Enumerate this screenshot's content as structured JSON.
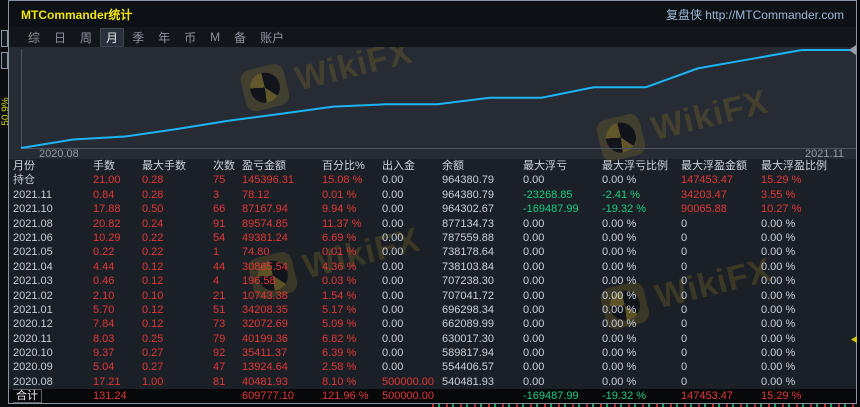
{
  "window": {
    "title": "MTCommander统计",
    "brand": "复盘侠 http://MTCommander.com"
  },
  "menu": {
    "items": [
      {
        "label": "综",
        "selected": false
      },
      {
        "label": "日",
        "selected": false
      },
      {
        "label": "周",
        "selected": false
      },
      {
        "label": "月",
        "selected": true
      },
      {
        "label": "季",
        "selected": false
      },
      {
        "label": "年",
        "selected": false
      },
      {
        "label": "币",
        "selected": false
      },
      {
        "label": "M",
        "selected": false
      },
      {
        "label": "备",
        "selected": false
      },
      {
        "label": "账户",
        "selected": false
      }
    ]
  },
  "chart_data": {
    "type": "line",
    "title": "账户余额曲线",
    "x_start_label": "2020.08",
    "x_end_label": "2021.11",
    "ylim": [
      500000,
      964381
    ],
    "line_color": "#1db4f6",
    "grid": false,
    "legend": false,
    "series": [
      {
        "name": "余额",
        "start_value": 500000,
        "x": [
          "2020.08",
          "2020.09",
          "2020.10",
          "2020.11",
          "2020.12",
          "2021.01",
          "2021.02",
          "2021.03",
          "2021.04",
          "2021.05",
          "2021.06",
          "2021.07",
          "2021.08",
          "2021.09",
          "2021.10",
          "2021.11"
        ],
        "y": [
          540481.93,
          554406.57,
          589817.94,
          630017.3,
          662089.99,
          696298.34,
          707041.72,
          707238.3,
          738103.84,
          738178.64,
          787559.88,
          787559.88,
          877134.73,
          920718.7,
          964302.67,
          964380.79
        ]
      }
    ]
  },
  "watermark": {
    "text": "WikiFX"
  },
  "underlying": {
    "side_label": "50.9%"
  },
  "colors": {
    "title_yellow": "#f0e40a",
    "profit_red": "#e23636",
    "loss_green": "#16cd82",
    "equity_line": "#1db4f6"
  },
  "table": {
    "columns": [
      "月份",
      "手数",
      "最大手数",
      "次数",
      "盈亏金额",
      "百分比%",
      "出入金",
      "余额",
      "最大浮亏",
      "最大浮亏比例",
      "最大浮盈金额",
      "最大浮盈比例"
    ],
    "rows": [
      {
        "label": "持仓",
        "total": false,
        "cells": [
          [
            "21.00",
            "r"
          ],
          [
            "0.28",
            "r"
          ],
          [
            "75",
            "r"
          ],
          [
            "145396.31",
            "r"
          ],
          [
            "15.08 %",
            "r"
          ],
          [
            "0.00",
            "w"
          ],
          [
            "964380.79",
            "w"
          ],
          [
            "0.00",
            "w"
          ],
          [
            "0.00 %",
            "w"
          ],
          [
            "147453.47",
            "r"
          ],
          [
            "15.29 %",
            "r"
          ]
        ]
      },
      {
        "label": "2021.11",
        "total": false,
        "cells": [
          [
            "0.84",
            "r"
          ],
          [
            "0.28",
            "r"
          ],
          [
            "3",
            "r"
          ],
          [
            "78.12",
            "r"
          ],
          [
            "0.01 %",
            "r"
          ],
          [
            "0.00",
            "w"
          ],
          [
            "964380.79",
            "w"
          ],
          [
            "-23268.85",
            "g"
          ],
          [
            "-2.41 %",
            "g"
          ],
          [
            "34203.47",
            "r"
          ],
          [
            "3.55 %",
            "r"
          ]
        ]
      },
      {
        "label": "2021.10",
        "total": false,
        "cells": [
          [
            "17.88",
            "r"
          ],
          [
            "0.50",
            "r"
          ],
          [
            "66",
            "r"
          ],
          [
            "87167.94",
            "r"
          ],
          [
            "9.94 %",
            "r"
          ],
          [
            "0.00",
            "w"
          ],
          [
            "964302.67",
            "w"
          ],
          [
            "-169487.99",
            "g"
          ],
          [
            "-19.32 %",
            "g"
          ],
          [
            "90065.88",
            "r"
          ],
          [
            "10.27 %",
            "r"
          ]
        ]
      },
      {
        "label": "2021.08",
        "total": false,
        "cells": [
          [
            "20.82",
            "r"
          ],
          [
            "0.24",
            "r"
          ],
          [
            "91",
            "r"
          ],
          [
            "89574.85",
            "r"
          ],
          [
            "11.37 %",
            "r"
          ],
          [
            "0.00",
            "w"
          ],
          [
            "877134.73",
            "w"
          ],
          [
            "0.00",
            "w"
          ],
          [
            "0.00 %",
            "w"
          ],
          [
            "0",
            "w"
          ],
          [
            "0.00 %",
            "w"
          ]
        ]
      },
      {
        "label": "2021.06",
        "total": false,
        "cells": [
          [
            "10.29",
            "r"
          ],
          [
            "0.22",
            "r"
          ],
          [
            "54",
            "r"
          ],
          [
            "49381.24",
            "r"
          ],
          [
            "6.69 %",
            "r"
          ],
          [
            "0.00",
            "w"
          ],
          [
            "787559.88",
            "w"
          ],
          [
            "0.00",
            "w"
          ],
          [
            "0.00 %",
            "w"
          ],
          [
            "0",
            "w"
          ],
          [
            "0.00 %",
            "w"
          ]
        ]
      },
      {
        "label": "2021.05",
        "total": false,
        "cells": [
          [
            "0.22",
            "r"
          ],
          [
            "0.22",
            "r"
          ],
          [
            "1",
            "r"
          ],
          [
            "74.80",
            "r"
          ],
          [
            "0.01 %",
            "r"
          ],
          [
            "0.00",
            "w"
          ],
          [
            "738178.64",
            "w"
          ],
          [
            "0.00",
            "w"
          ],
          [
            "0.00 %",
            "w"
          ],
          [
            "0",
            "w"
          ],
          [
            "0.00 %",
            "w"
          ]
        ]
      },
      {
        "label": "2021.04",
        "total": false,
        "cells": [
          [
            "4.44",
            "r"
          ],
          [
            "0.12",
            "r"
          ],
          [
            "44",
            "r"
          ],
          [
            "30865.54",
            "r"
          ],
          [
            "4.36 %",
            "r"
          ],
          [
            "0.00",
            "w"
          ],
          [
            "738103.84",
            "w"
          ],
          [
            "0.00",
            "w"
          ],
          [
            "0.00 %",
            "w"
          ],
          [
            "0",
            "w"
          ],
          [
            "0.00 %",
            "w"
          ]
        ]
      },
      {
        "label": "2021.03",
        "total": false,
        "cells": [
          [
            "0.46",
            "r"
          ],
          [
            "0.12",
            "r"
          ],
          [
            "4",
            "r"
          ],
          [
            "196.58",
            "r"
          ],
          [
            "0.03 %",
            "r"
          ],
          [
            "0.00",
            "w"
          ],
          [
            "707238.30",
            "w"
          ],
          [
            "0.00",
            "w"
          ],
          [
            "0.00 %",
            "w"
          ],
          [
            "0",
            "w"
          ],
          [
            "0.00 %",
            "w"
          ]
        ]
      },
      {
        "label": "2021.02",
        "total": false,
        "cells": [
          [
            "2.10",
            "r"
          ],
          [
            "0.10",
            "r"
          ],
          [
            "21",
            "r"
          ],
          [
            "10743.38",
            "r"
          ],
          [
            "1.54 %",
            "r"
          ],
          [
            "0.00",
            "w"
          ],
          [
            "707041.72",
            "w"
          ],
          [
            "0.00",
            "w"
          ],
          [
            "0.00 %",
            "w"
          ],
          [
            "0",
            "w"
          ],
          [
            "0.00 %",
            "w"
          ]
        ]
      },
      {
        "label": "2021.01",
        "total": false,
        "cells": [
          [
            "5.70",
            "r"
          ],
          [
            "0.12",
            "r"
          ],
          [
            "51",
            "r"
          ],
          [
            "34208.35",
            "r"
          ],
          [
            "5.17 %",
            "r"
          ],
          [
            "0.00",
            "w"
          ],
          [
            "696298.34",
            "w"
          ],
          [
            "0.00",
            "w"
          ],
          [
            "0.00 %",
            "w"
          ],
          [
            "0",
            "w"
          ],
          [
            "0.00 %",
            "w"
          ]
        ]
      },
      {
        "label": "2020.12",
        "total": false,
        "cells": [
          [
            "7.84",
            "r"
          ],
          [
            "0.12",
            "r"
          ],
          [
            "73",
            "r"
          ],
          [
            "32072.69",
            "r"
          ],
          [
            "5.09 %",
            "r"
          ],
          [
            "0.00",
            "w"
          ],
          [
            "662089.99",
            "w"
          ],
          [
            "0.00",
            "w"
          ],
          [
            "0.00 %",
            "w"
          ],
          [
            "0",
            "w"
          ],
          [
            "0.00 %",
            "w"
          ]
        ]
      },
      {
        "label": "2020.11",
        "total": false,
        "cells": [
          [
            "8.03",
            "r"
          ],
          [
            "0.25",
            "r"
          ],
          [
            "79",
            "r"
          ],
          [
            "40199.36",
            "r"
          ],
          [
            "6.82 %",
            "r"
          ],
          [
            "0.00",
            "w"
          ],
          [
            "630017.30",
            "w"
          ],
          [
            "0.00",
            "w"
          ],
          [
            "0.00 %",
            "w"
          ],
          [
            "0",
            "w"
          ],
          [
            "0.00 %",
            "w"
          ]
        ]
      },
      {
        "label": "2020.10",
        "total": false,
        "cells": [
          [
            "9.37",
            "r"
          ],
          [
            "0.27",
            "r"
          ],
          [
            "92",
            "r"
          ],
          [
            "35411.37",
            "r"
          ],
          [
            "6.39 %",
            "r"
          ],
          [
            "0.00",
            "w"
          ],
          [
            "589817.94",
            "w"
          ],
          [
            "0.00",
            "w"
          ],
          [
            "0.00 %",
            "w"
          ],
          [
            "0",
            "w"
          ],
          [
            "0.00 %",
            "w"
          ]
        ]
      },
      {
        "label": "2020.09",
        "total": false,
        "cells": [
          [
            "5.04",
            "r"
          ],
          [
            "0.27",
            "r"
          ],
          [
            "47",
            "r"
          ],
          [
            "13924.64",
            "r"
          ],
          [
            "2.58 %",
            "r"
          ],
          [
            "0.00",
            "w"
          ],
          [
            "554406.57",
            "w"
          ],
          [
            "0.00",
            "w"
          ],
          [
            "0.00 %",
            "w"
          ],
          [
            "0",
            "w"
          ],
          [
            "0.00 %",
            "w"
          ]
        ]
      },
      {
        "label": "2020.08",
        "total": false,
        "cells": [
          [
            "17.21",
            "r"
          ],
          [
            "1.00",
            "r"
          ],
          [
            "81",
            "r"
          ],
          [
            "40481.93",
            "r"
          ],
          [
            "8.10 %",
            "r"
          ],
          [
            "500000.00",
            "r"
          ],
          [
            "540481.93",
            "w"
          ],
          [
            "0.00",
            "w"
          ],
          [
            "0.00 %",
            "w"
          ],
          [
            "0",
            "w"
          ],
          [
            "0.00 %",
            "w"
          ]
        ]
      },
      {
        "label": "合计",
        "total": true,
        "cells": [
          [
            "131.24",
            "r"
          ],
          [
            "",
            ""
          ],
          [
            "",
            ""
          ],
          [
            "609777.10",
            "r"
          ],
          [
            "121.96 %",
            "r"
          ],
          [
            "500000.00",
            "r"
          ],
          [
            "",
            ""
          ],
          [
            "-169487.99",
            "g"
          ],
          [
            "-19.32 %",
            "g"
          ],
          [
            "147453.47",
            "r"
          ],
          [
            "15.29 %",
            "r"
          ]
        ]
      }
    ]
  }
}
